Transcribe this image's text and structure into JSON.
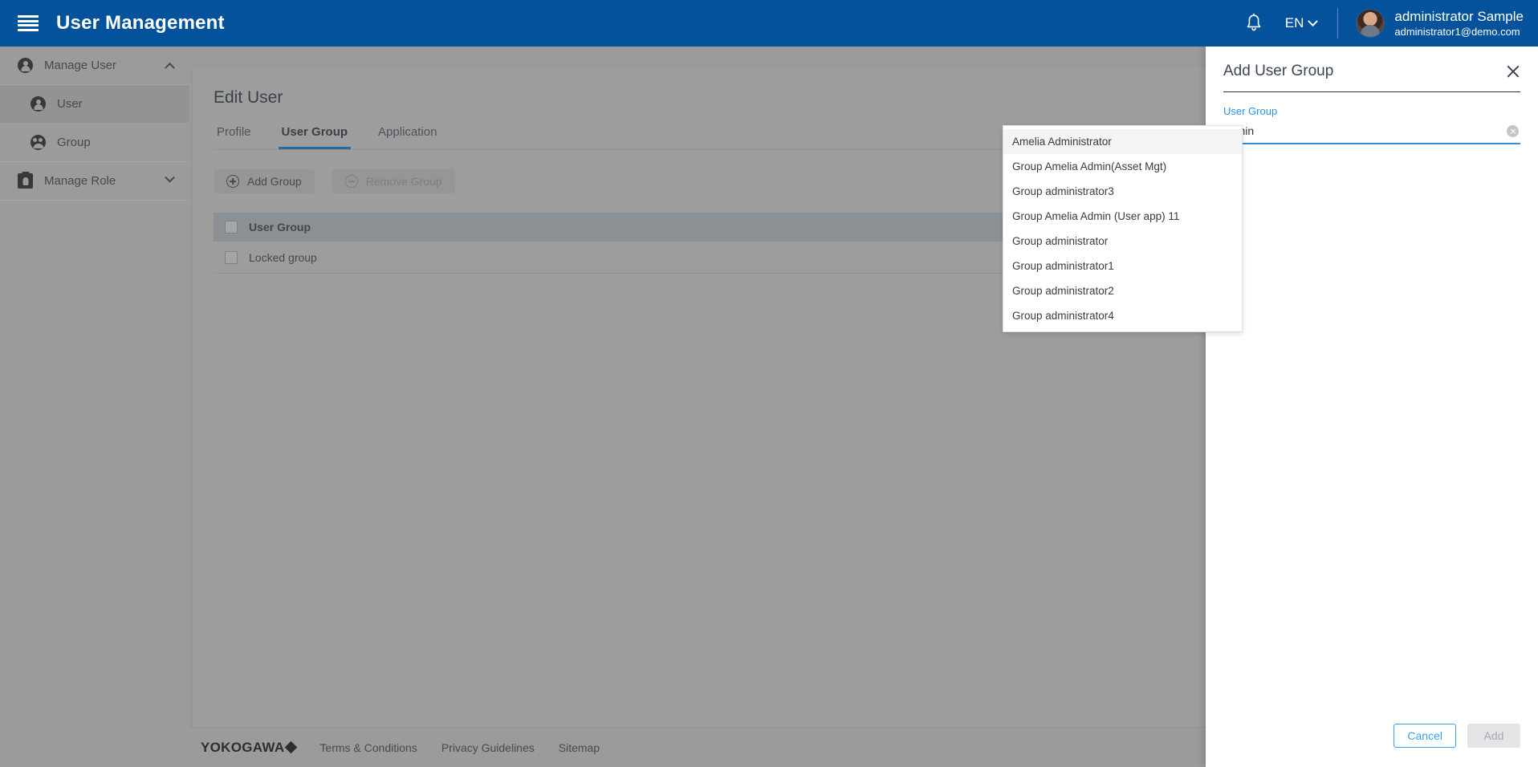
{
  "appbar": {
    "menu_icon": "hamburger-icon",
    "title": "User Management",
    "bell_icon": "notification-bell-icon",
    "language": "EN",
    "user_name": "administrator Sample",
    "user_email": "administrator1@demo.com"
  },
  "sidebar": {
    "items": [
      {
        "label": "Manage User",
        "icon": "person-icon",
        "level": "parent",
        "state": "expanded",
        "selected": false
      },
      {
        "label": "User",
        "icon": "person-icon",
        "level": "child",
        "state": "",
        "selected": true
      },
      {
        "label": "Group",
        "icon": "group-icon",
        "level": "child",
        "state": "",
        "selected": false
      },
      {
        "label": "Manage Role",
        "icon": "badge-icon",
        "level": "parent",
        "state": "collapsed",
        "selected": false
      }
    ]
  },
  "main": {
    "page_title": "Edit User",
    "tabs": [
      {
        "label": "Profile",
        "active": false
      },
      {
        "label": "User Group",
        "active": true
      },
      {
        "label": "Application",
        "active": false
      }
    ],
    "buttons": {
      "add_group": "Add Group",
      "remove_group": "Remove Group",
      "remove_group_disabled": true
    },
    "table": {
      "columns": [
        "User Group"
      ],
      "rows": [
        {
          "user_group": "Locked group",
          "checked": false
        }
      ]
    }
  },
  "footer": {
    "brand": "YOKOGAWA",
    "links": [
      "Terms & Conditions",
      "Privacy Guidelines",
      "Sitemap"
    ]
  },
  "drawer": {
    "title": "Add User Group",
    "close_icon": "close-icon",
    "field_label": "User Group",
    "field_value": "admin",
    "field_placeholder": "",
    "clear_icon": "clear-circle-icon",
    "options": [
      {
        "label": "Amelia Administrator",
        "highlighted": true
      },
      {
        "label": "Group Amelia Admin(Asset Mgt)",
        "highlighted": false
      },
      {
        "label": "Group administrator3",
        "highlighted": false
      },
      {
        "label": "Group Amelia Admin (User app) 11",
        "highlighted": false
      },
      {
        "label": "Group administrator",
        "highlighted": false
      },
      {
        "label": "Group administrator1",
        "highlighted": false
      },
      {
        "label": "Group administrator2",
        "highlighted": false
      },
      {
        "label": "Group administrator4",
        "highlighted": false
      }
    ],
    "cancel_label": "Cancel",
    "add_label": "Add",
    "add_disabled": true
  },
  "colors": {
    "appbar_blue": "#04529b",
    "accent_blue": "#1071c4",
    "link_blue": "#2e8fe0",
    "surface_grey": "#b4b4b4"
  }
}
